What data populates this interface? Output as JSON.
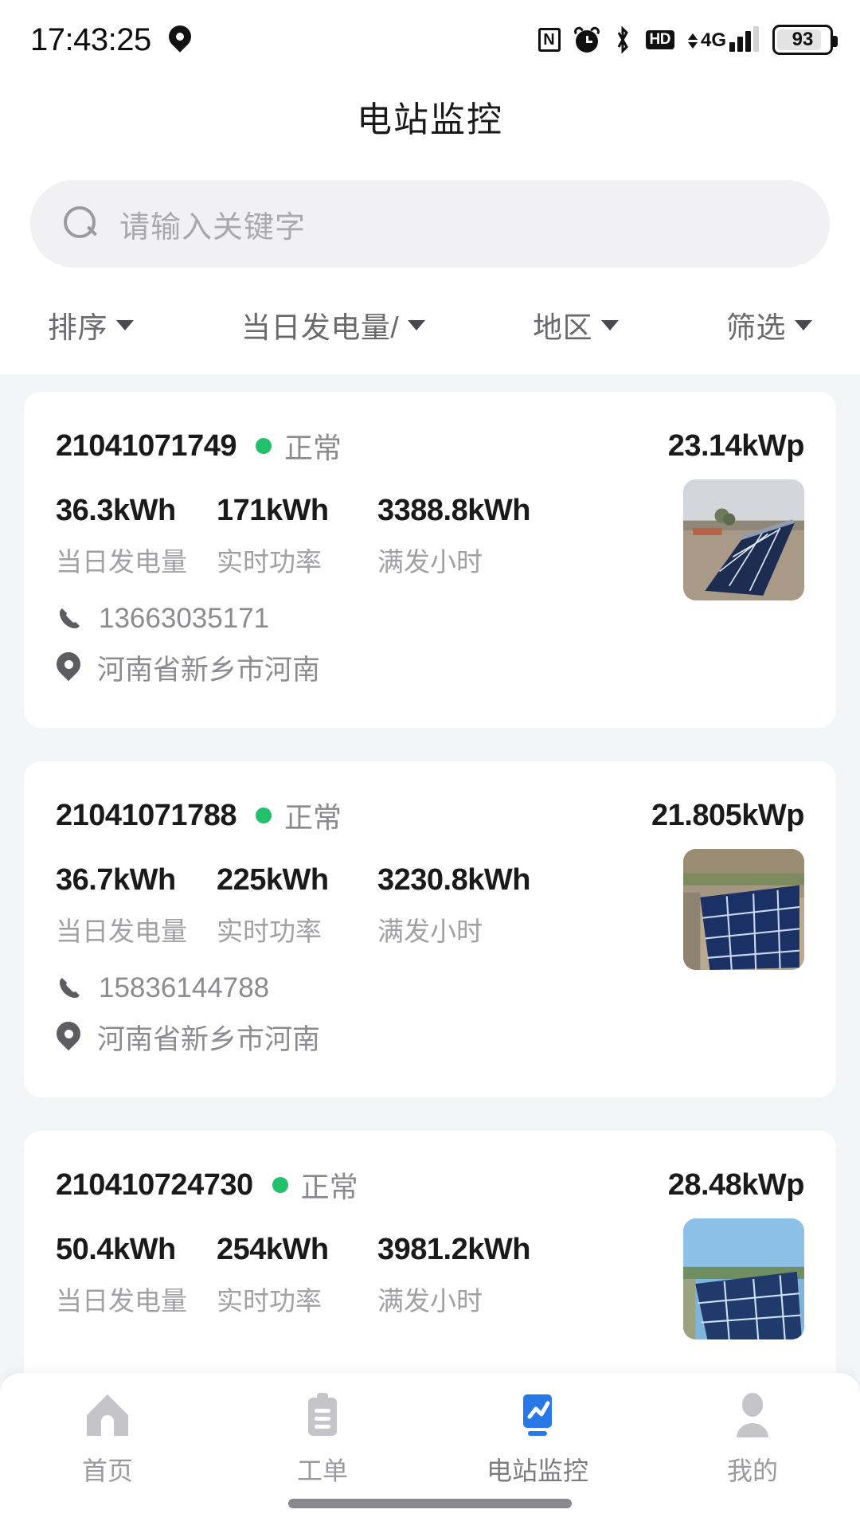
{
  "statusbar": {
    "time": "17:43:25",
    "location_icon": "location-pin-icon",
    "icons": [
      "nfc-icon",
      "alarm-icon",
      "bluetooth-icon",
      "hd-icon",
      "4g-icon",
      "signal-icon"
    ],
    "nfc_label": "N",
    "hd_label": "HD",
    "network_label": "4G",
    "battery_level": "93"
  },
  "header": {
    "title": "电站监控"
  },
  "search": {
    "placeholder": "请输入关键字",
    "value": "",
    "icon": "search-icon"
  },
  "filters": [
    {
      "label": "排序",
      "icon": "chevron-down-icon"
    },
    {
      "label": "当日发电量/",
      "icon": "chevron-down-icon"
    },
    {
      "label": "地区",
      "icon": "chevron-down-icon"
    },
    {
      "label": "筛选",
      "icon": "chevron-down-icon"
    }
  ],
  "metric_labels": {
    "daily": "当日发电量",
    "power": "实时功率",
    "fullhours": "满发小时"
  },
  "stations": [
    {
      "id": "21041071749",
      "status": "正常",
      "status_color": "#22c06a",
      "capacity": "23.14kWp",
      "daily_value": "36.3kWh",
      "power_value": "171kWh",
      "fullhours_value": "3388.8kWh",
      "phone": "13663035171",
      "address": "河南省新乡市河南",
      "thumbnail": "solar-panel-photo"
    },
    {
      "id": "21041071788",
      "status": "正常",
      "status_color": "#22c06a",
      "capacity": "21.805kWp",
      "daily_value": "36.7kWh",
      "power_value": "225kWh",
      "fullhours_value": "3230.8kWh",
      "phone": "15836144788",
      "address": "河南省新乡市河南",
      "thumbnail": "solar-panel-photo"
    },
    {
      "id": "210410724730",
      "status": "正常",
      "status_color": "#22c06a",
      "capacity": "28.48kWp",
      "daily_value": "50.4kWh",
      "power_value": "254kWh",
      "fullhours_value": "3981.2kWh",
      "phone": "",
      "address": "",
      "thumbnail": "solar-panel-photo"
    }
  ],
  "bottomnav": {
    "active_color": "#2878e8",
    "items": [
      {
        "label": "首页",
        "icon": "home-icon",
        "active": false
      },
      {
        "label": "工单",
        "icon": "clipboard-icon",
        "active": false
      },
      {
        "label": "电站监控",
        "icon": "chart-icon",
        "active": true
      },
      {
        "label": "我的",
        "icon": "person-icon",
        "active": false
      }
    ]
  }
}
